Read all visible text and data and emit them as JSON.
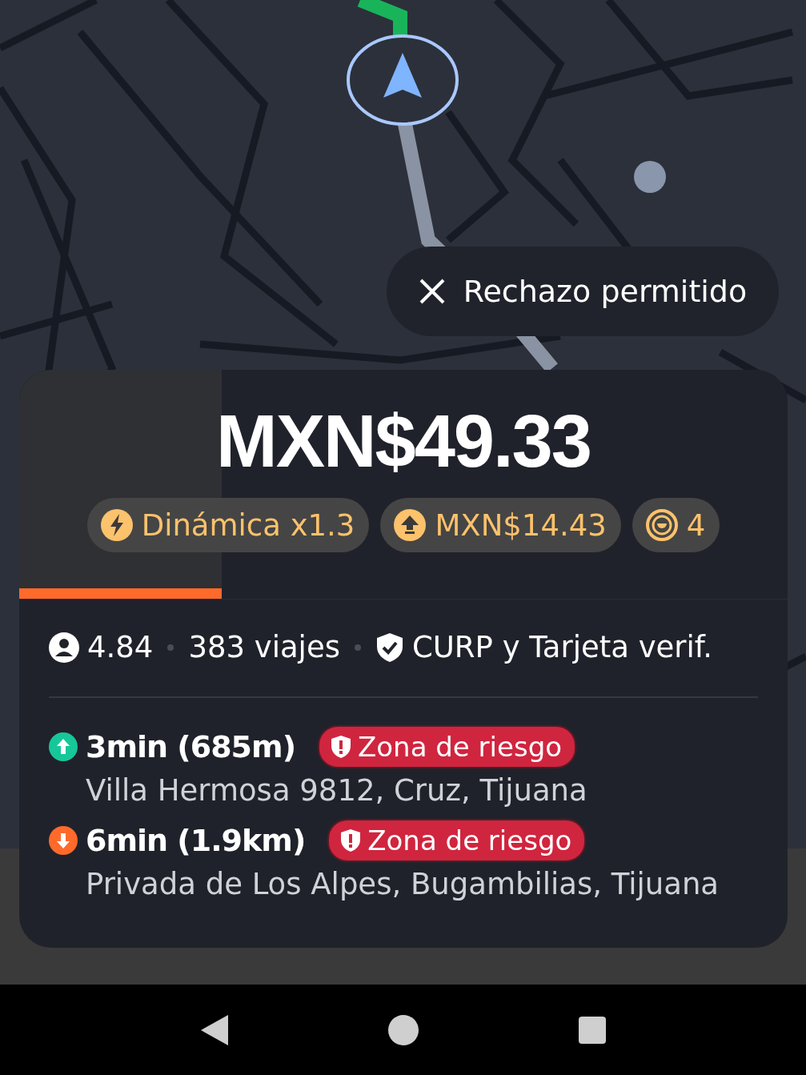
{
  "reject_chip": {
    "label": "Rechazo permitido"
  },
  "offer": {
    "price": "MXN$49.33",
    "timer": {
      "level": 0.264
    },
    "chips": [
      {
        "kind": "surge",
        "label": "Dinámica x1.3"
      },
      {
        "kind": "bonus",
        "label": "MXN$14.43"
      },
      {
        "kind": "points",
        "label": "4"
      }
    ]
  },
  "rider": {
    "rating": "4.84",
    "trips": "383 viajes",
    "verification": "CURP y Tarjeta verif."
  },
  "stops": [
    {
      "kind": "pickup",
      "eta": "3min (685m)",
      "badge": "Zona de riesgo",
      "address": "Villa Hermosa 9812, Cruz, Tijuana"
    },
    {
      "kind": "dropoff",
      "eta": "6min (1.9km)",
      "badge": "Zona de riesgo",
      "address": "Privada de Los Alpes, Bugambilias, Tijuana"
    }
  ]
}
